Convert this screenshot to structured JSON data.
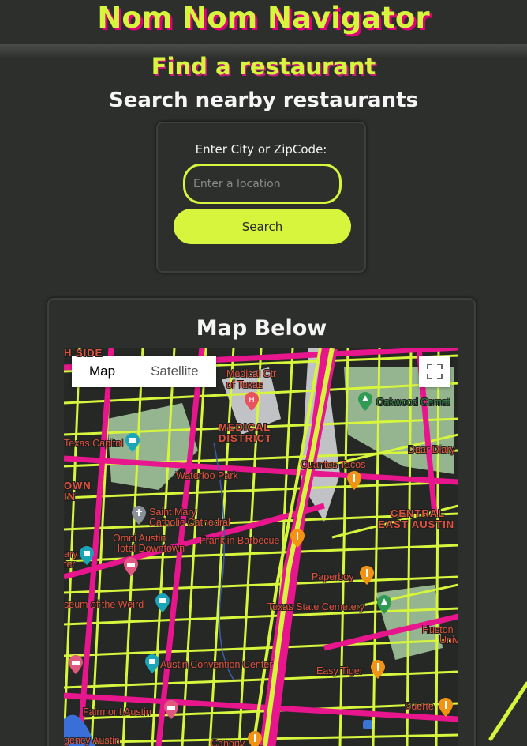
{
  "header": {
    "title": "Nom Nom Navigator"
  },
  "page": {
    "find_title": "Find a restaurant",
    "search_subtitle": "Search nearby restaurants"
  },
  "search": {
    "label": "Enter City or ZipCode:",
    "placeholder": "Enter a location",
    "value": "",
    "button_label": "Search"
  },
  "map": {
    "title": "Map Below",
    "type_buttons": [
      "Map",
      "Satellite"
    ],
    "active_type": "Map",
    "labels": {
      "south_side": "H SIDE",
      "medical_ctr": "Medical Ctr",
      "of_texas": "of Texas",
      "medical_district_1": "MEDICAL",
      "medical_district_2": "DISTRICT",
      "texas_capitol": "Texas Capitol",
      "oakwood": "Oakwood Cemet",
      "dear_diary": "Dear Diary",
      "cuantos_tacos": "Cuantos Tacos",
      "waterloo_park": "Waterloo Park",
      "own": "OWN",
      "in": "IN",
      "saint_mary_1": "Saint Mary",
      "saint_mary_2": "Catholic Cathedral",
      "central_east_1": "CENTRAL",
      "central_east_2": "EAST AUSTIN",
      "omni_1": "Omni Austin",
      "omni_2": "Hotel Downtown",
      "franklin": "Franklin Barbecue",
      "ary": "ary",
      "ter": "ter",
      "paperboy": "Paperboy",
      "museum_weird": "seum of the Weird",
      "texas_cemetery": "Texas State Cemetery",
      "huston_1": "Huston",
      "huston_2": "Univ",
      "convention": "Austin Convention Center",
      "easy_tiger": "Easy Tiger",
      "fairmont": "Fairmont Austin",
      "suerte": "Suerte",
      "gency": "gency Austin",
      "canopy": "Canopy"
    }
  },
  "colors": {
    "accent": "#d6f53c",
    "accent_shadow": "#e0007a",
    "background": "#2d2f2c",
    "map_road_major": "#e8168c",
    "map_road_minor": "#d6f53c",
    "map_label": "#e0503f"
  },
  "icons": {
    "fullscreen": "fullscreen-icon",
    "hospital": "hospital-pin-icon",
    "restaurant": "restaurant-pin-icon",
    "museum": "museum-pin-icon",
    "hotel": "hotel-pin-icon",
    "park": "park-pin-icon",
    "church": "church-pin-icon"
  }
}
